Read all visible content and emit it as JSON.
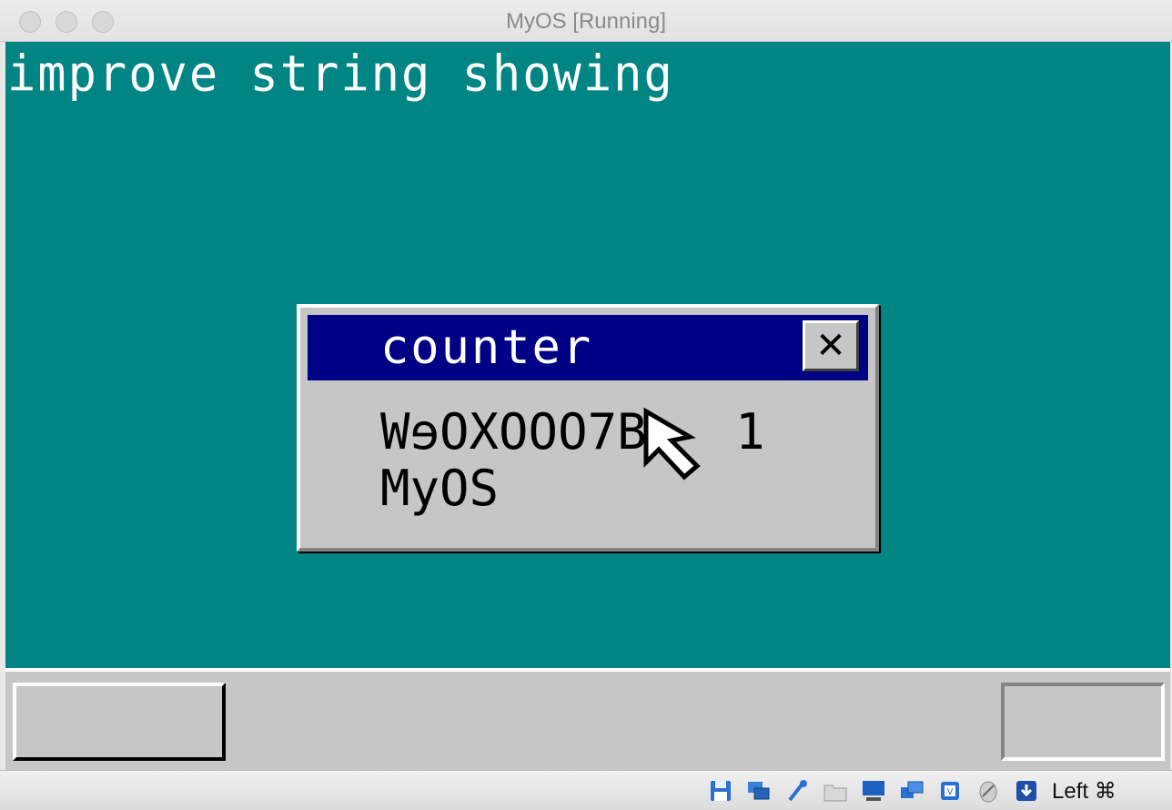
{
  "window": {
    "title": "MyOS [Running]"
  },
  "guest": {
    "desktop_message": "improve string showing",
    "counter_window": {
      "title": "counter",
      "close_glyph": "✕",
      "value_line": "WɘOXOOO7B   1",
      "label_line": "MyOS"
    },
    "colors": {
      "desktop": "#008484",
      "window_body": "#c6c6c6",
      "titlebar_active": "#000084",
      "text_light": "#ffffff",
      "text_dark": "#000000"
    }
  },
  "statusbar": {
    "icons": [
      "floppy-disk-icon",
      "network-adapters-icon",
      "usb-icon",
      "shared-folder-icon",
      "display-icon",
      "virtual-screens-icon",
      "cpu-icon",
      "mouse-integration-icon",
      "download-arrow-icon"
    ],
    "host_key_label": "Left ⌘"
  }
}
